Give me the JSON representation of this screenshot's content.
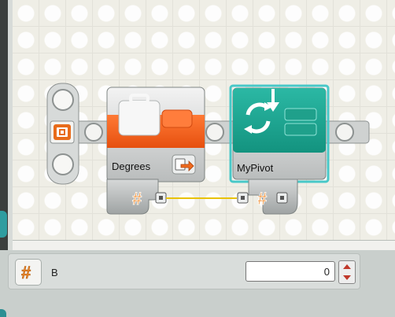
{
  "blocks": {
    "variable_block": {
      "label": "Degrees"
    },
    "my_block": {
      "label": "MyPivot"
    }
  },
  "data_hub": {
    "type_symbol": "#"
  },
  "config_panel": {
    "icon_symbol": "#",
    "param_label": "B",
    "param_value": "0"
  },
  "colors": {
    "variable_accent": "#f05c1c",
    "myblock_accent": "#20a896",
    "wire": "#e8c200",
    "selection_outline": "#48c8c8"
  },
  "icons": [
    "briefcase-icon",
    "arrow-out-icon",
    "pivot-icon",
    "number-hash-icon",
    "stepper-up-icon",
    "stepper-down-icon"
  ]
}
